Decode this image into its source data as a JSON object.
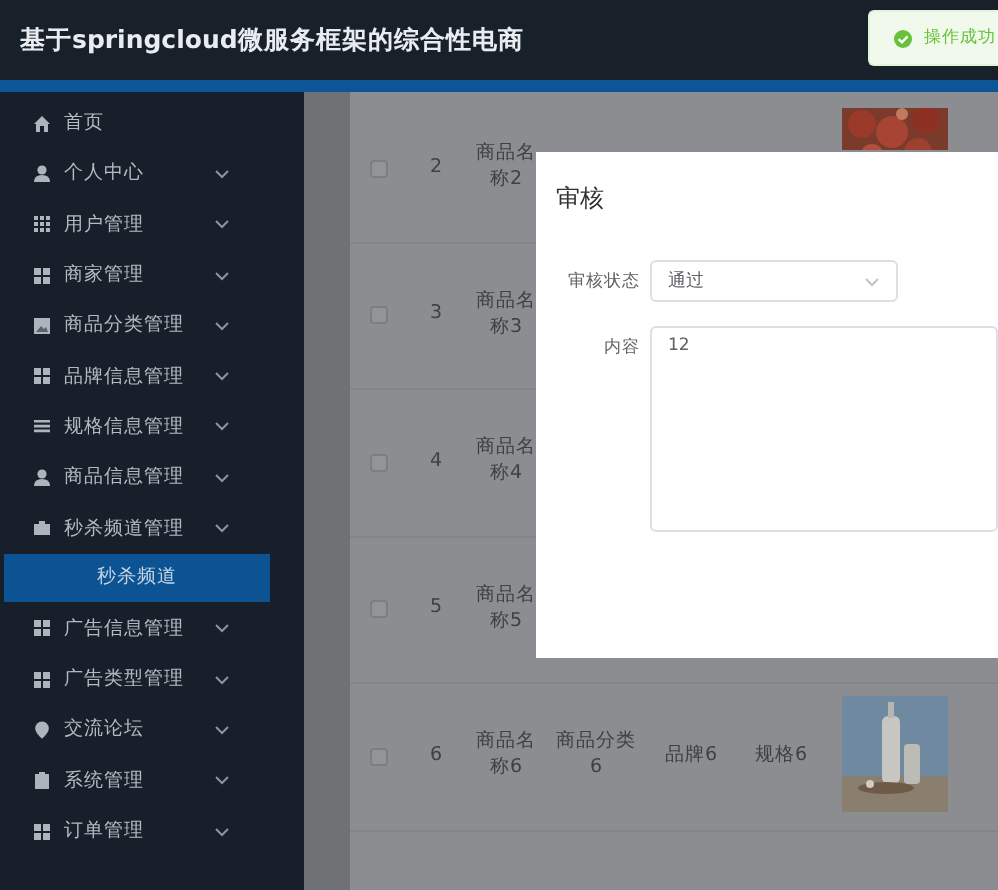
{
  "header": {
    "title": "基于springcloud微服务框架的综合性电商"
  },
  "toast": {
    "text": "操作成功"
  },
  "sidebar": {
    "items": [
      {
        "label": "首页",
        "expandable": false
      },
      {
        "label": "个人中心",
        "expandable": true
      },
      {
        "label": "用户管理",
        "expandable": true
      },
      {
        "label": "商家管理",
        "expandable": true
      },
      {
        "label": "商品分类管理",
        "expandable": true
      },
      {
        "label": "品牌信息管理",
        "expandable": true
      },
      {
        "label": "规格信息管理",
        "expandable": true
      },
      {
        "label": "商品信息管理",
        "expandable": true
      },
      {
        "label": "秒杀频道管理",
        "expandable": true,
        "children": [
          {
            "label": "秒杀频道",
            "selected": true
          }
        ]
      },
      {
        "label": "广告信息管理",
        "expandable": true
      },
      {
        "label": "广告类型管理",
        "expandable": true
      },
      {
        "label": "交流论坛",
        "expandable": true
      },
      {
        "label": "系统管理",
        "expandable": true
      },
      {
        "label": "订单管理",
        "expandable": true
      }
    ]
  },
  "table": {
    "rows": [
      {
        "checked": false,
        "index": "2",
        "name": "商品名称2",
        "picture": true
      },
      {
        "checked": false,
        "index": "3",
        "name": "商品名称3",
        "picture": false
      },
      {
        "checked": false,
        "index": "4",
        "name": "商品名称4",
        "picture": false
      },
      {
        "checked": false,
        "index": "5",
        "name": "商品名称5",
        "picture": false
      },
      {
        "checked": false,
        "index": "6",
        "name": "商品名称6",
        "category": "商品分类6",
        "brand": "品牌6",
        "spec": "规格6",
        "picture": true
      }
    ]
  },
  "dialog": {
    "title": "审核",
    "fields": [
      {
        "kind": "select",
        "label": "审核状态",
        "value": "通过"
      },
      {
        "kind": "textarea",
        "label": "内容",
        "value": "12"
      }
    ]
  }
}
